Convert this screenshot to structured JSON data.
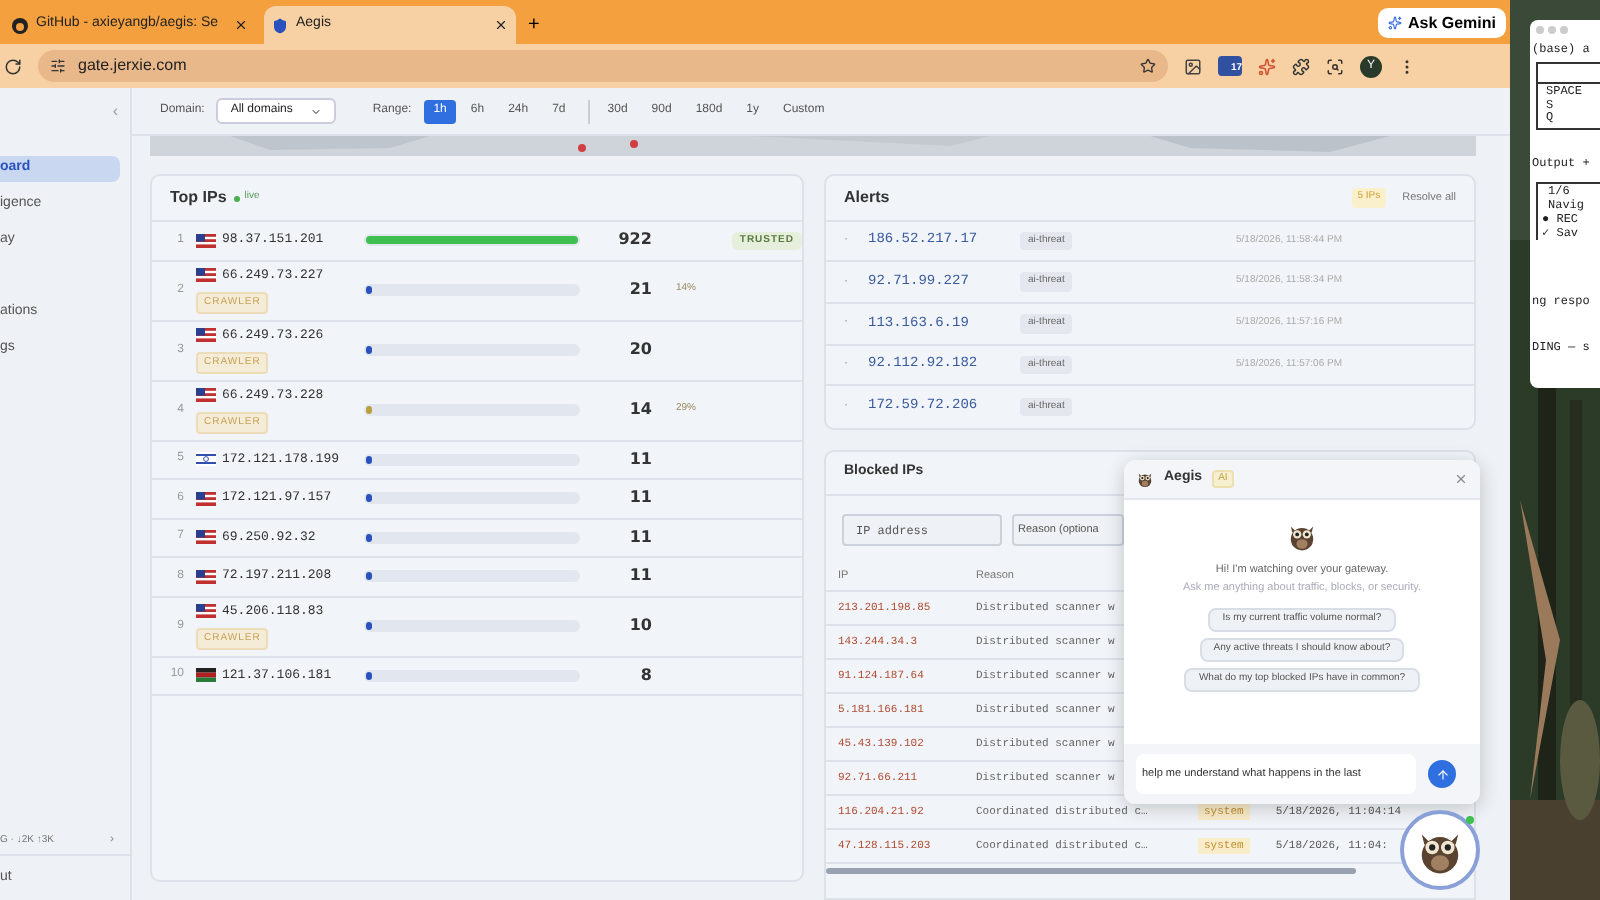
{
  "browser": {
    "tabs": [
      {
        "title": "GitHub - axieyangb/aegis: Se",
        "kind": "github",
        "selected": false
      },
      {
        "title": "Aegis",
        "kind": "shield",
        "selected": true
      }
    ],
    "new_tab": "+",
    "ask_gemini": "Ask Gemini",
    "url": "gate.jerxie.com",
    "extension_badge": "17",
    "avatar": "Y"
  },
  "sidebar": {
    "collapse": "‹",
    "groups": [
      {
        "items": [
          {
            "label": "oard",
            "selected": true
          },
          {
            "label": "igence",
            "selected": false
          },
          {
            "label": "ay",
            "selected": false
          }
        ]
      },
      {
        "items": [
          {
            "label": "ations",
            "selected": false
          },
          {
            "label": "gs",
            "selected": false
          }
        ]
      }
    ],
    "traffic": "G · ↓2K ↑3K",
    "traffic_chevron": "›",
    "footer": "ut"
  },
  "filters": {
    "domain_label": "Domain:",
    "domain_value": "All domains",
    "range_label": "Range:",
    "range_groups": [
      {
        "items": [
          {
            "label": "1h",
            "selected": true
          },
          {
            "label": "6h",
            "selected": false
          },
          {
            "label": "24h",
            "selected": false
          },
          {
            "label": "7d",
            "selected": false
          }
        ]
      },
      {
        "items": [
          {
            "label": "30d",
            "selected": false
          },
          {
            "label": "90d",
            "selected": false
          },
          {
            "label": "180d",
            "selected": false
          },
          {
            "label": "1y",
            "selected": false
          },
          {
            "label": "Custom",
            "selected": false
          }
        ]
      }
    ]
  },
  "top_ips": {
    "title": "Top IPs",
    "live": "live",
    "rows": [
      {
        "rank": "1",
        "kind": "us",
        "ip": "98.37.151.201",
        "level": 1,
        "color": "#3fbf4f",
        "count": "922",
        "badge": "TRUSTED"
      },
      {
        "rank": "2",
        "kind": "us",
        "ip": "66.249.73.227",
        "tag": "CRAWLER",
        "level": 0.023,
        "color": "#2a52be",
        "count": "21",
        "pct": "14%"
      },
      {
        "rank": "3",
        "kind": "us",
        "ip": "66.249.73.226",
        "tag": "CRAWLER",
        "level": 0.022,
        "color": "#2a52be",
        "count": "20"
      },
      {
        "rank": "4",
        "kind": "us",
        "ip": "66.249.73.228",
        "tag": "CRAWLER",
        "level": 0.015,
        "color": "#b8a040",
        "count": "14",
        "pct": "29%"
      },
      {
        "rank": "5",
        "kind": "il",
        "ip": "172.121.178.199",
        "level": 0.012,
        "color": "#2a52be",
        "count": "11"
      },
      {
        "rank": "6",
        "kind": "us",
        "ip": "172.121.97.157",
        "level": 0.012,
        "color": "#2a52be",
        "count": "11"
      },
      {
        "rank": "7",
        "kind": "us",
        "ip": "69.250.92.32",
        "level": 0.012,
        "color": "#2a52be",
        "count": "11"
      },
      {
        "rank": "8",
        "kind": "us",
        "ip": "72.197.211.208",
        "level": 0.012,
        "color": "#2a52be",
        "count": "11"
      },
      {
        "rank": "9",
        "kind": "us",
        "ip": "45.206.118.83",
        "tag": "CRAWLER",
        "level": 0.011,
        "color": "#2a52be",
        "count": "10"
      },
      {
        "rank": "10",
        "kind": "ke",
        "ip": "121.37.106.181",
        "level": 0.009,
        "color": "#2a52be",
        "count": "8"
      }
    ]
  },
  "alerts": {
    "title": "Alerts",
    "count_badge": "5 IPs",
    "resolve_all": "Resolve all",
    "rows": [
      {
        "marker": "·",
        "ip": "186.52.217.17",
        "tag": "ai-threat",
        "time": "5/18/2026, 11:58:44 PM"
      },
      {
        "marker": "·",
        "ip": "92.71.99.227",
        "tag": "ai-threat",
        "time": "5/18/2026, 11:58:34 PM"
      },
      {
        "marker": "·",
        "ip": "113.163.6.19",
        "tag": "ai-threat",
        "time": "5/18/2026, 11:57:16 PM"
      },
      {
        "marker": "·",
        "ip": "92.112.92.182",
        "tag": "ai-threat",
        "time": "5/18/2026, 11:57:06 PM"
      },
      {
        "marker": "·",
        "ip": "172.59.72.206",
        "tag": "ai-threat"
      }
    ]
  },
  "blocked_ips": {
    "title": "Blocked IPs",
    "ip_placeholder": "IP address",
    "reason_placeholder": "Reason (optiona",
    "columns": [
      "IP",
      "Reason"
    ],
    "rows": [
      {
        "ip": "213.201.198.85",
        "reason": "Distributed scanner w"
      },
      {
        "ip": "143.244.34.3",
        "reason": "Distributed scanner w"
      },
      {
        "ip": "91.124.187.64",
        "reason": "Distributed scanner w"
      },
      {
        "ip": "5.181.166.181",
        "reason": "Distributed scanner w"
      },
      {
        "ip": "45.43.139.102",
        "reason": "Distributed scanner w"
      },
      {
        "ip": "92.71.66.211",
        "reason": "Distributed scanner w"
      },
      {
        "ip": "116.204.21.92",
        "reason": "Coordinated distributed c…",
        "source": "system",
        "time": "5/18/2026, 11:04:14"
      },
      {
        "ip": "47.128.115.203",
        "reason": "Coordinated distributed c…",
        "source": "system",
        "time": "5/18/2026, 11:04:"
      }
    ]
  },
  "chat": {
    "title": "Aegis",
    "badge": "AI",
    "greeting": "Hi! I'm watching over your gateway.",
    "subtitle": "Ask me anything about traffic, blocks, or security.",
    "suggestions": [
      "Is my current traffic volume normal?",
      "Any active threats I should know about?",
      "What do my top blocked IPs have in common?"
    ],
    "input": "help me understand what happens in the last",
    "online": true
  },
  "terminal": {
    "prompt": "(base) a",
    "keys": [
      "SPACE",
      "S",
      "Q"
    ],
    "output": "Output +",
    "progress": "1/6",
    "nav": "Navig",
    "items": [
      {
        "marker": "●",
        "text": "REC"
      },
      {
        "marker": "✓",
        "text": "Sav"
      }
    ],
    "status": "ng respo",
    "footer": "DING — s"
  }
}
